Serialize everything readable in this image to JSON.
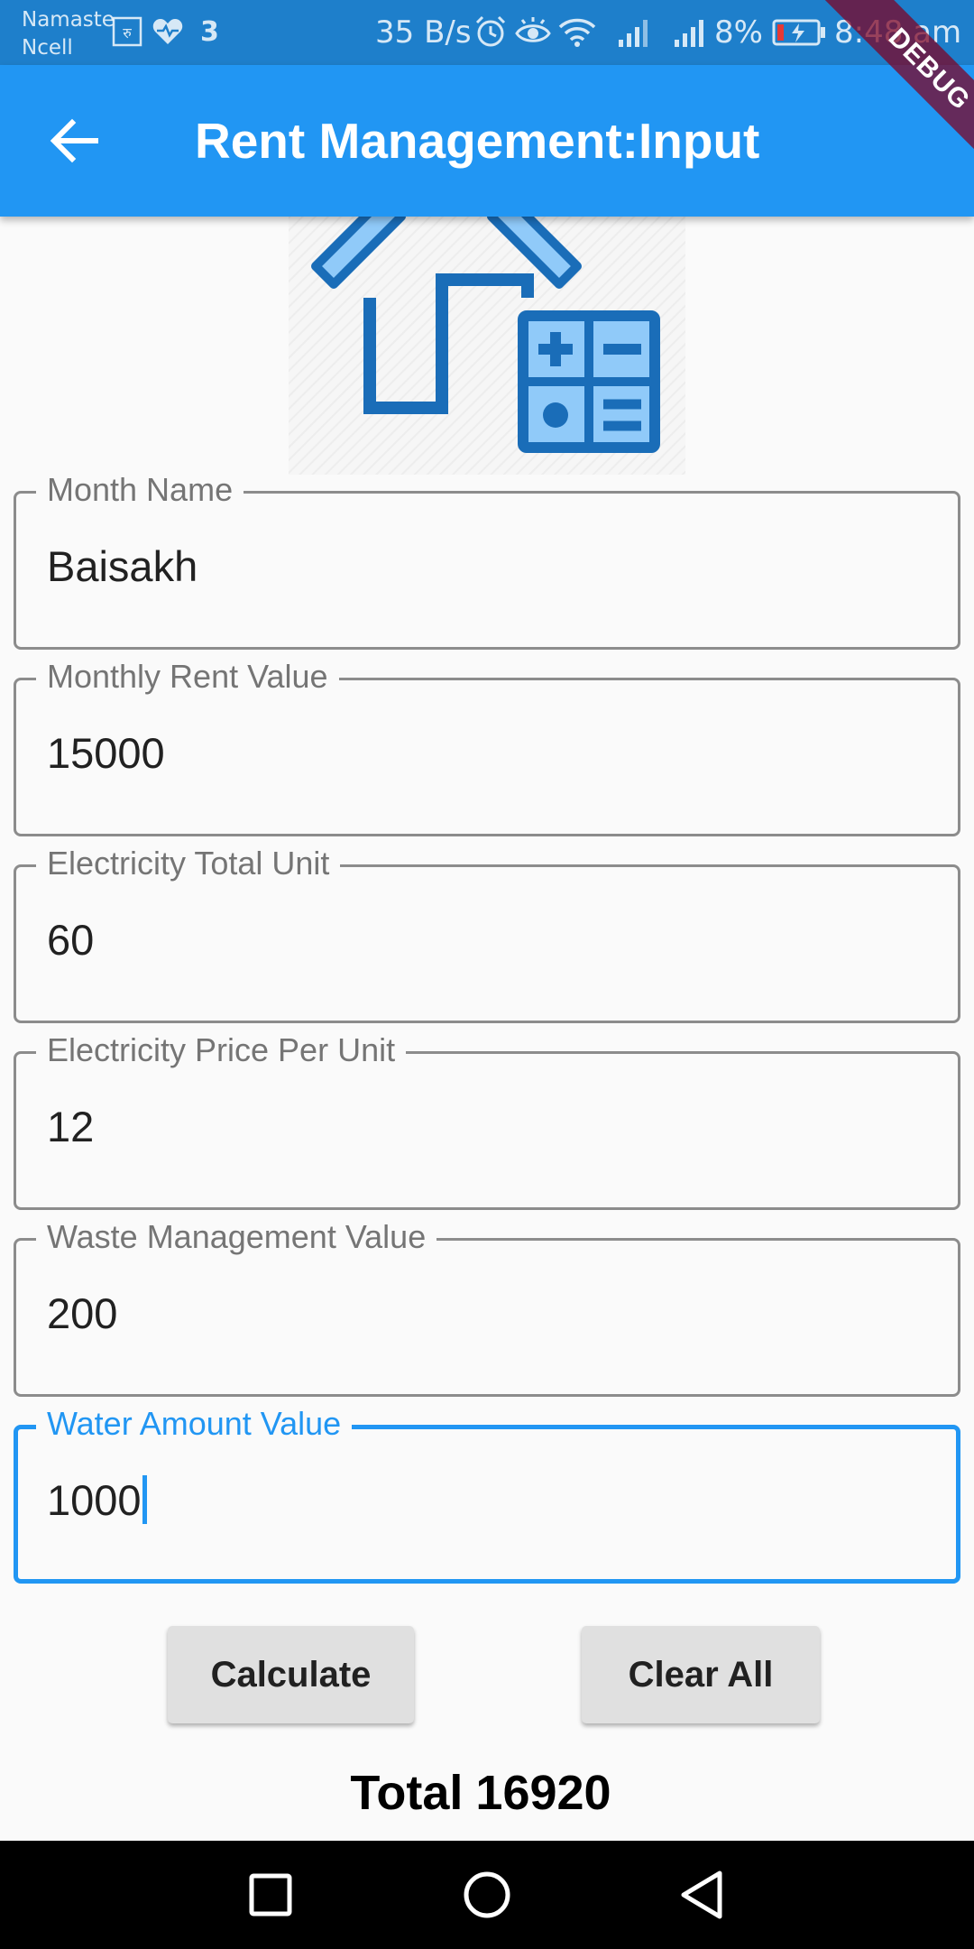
{
  "status_bar": {
    "carrier_line1": "Namaste",
    "carrier_line2": "Ncell",
    "notification_count": "3",
    "network_speed": "35 B/s",
    "battery_percent": "8%",
    "time": "8:48 am"
  },
  "app_bar": {
    "title": "Rent Management:Input",
    "back_icon": "arrow-back-icon"
  },
  "debug_banner": "DEBUG",
  "logo_icon": "house-calculator-icon",
  "fields": [
    {
      "label": "Month Name",
      "value": "Baisakh"
    },
    {
      "label": "Monthly Rent Value",
      "value": "15000"
    },
    {
      "label": "Electricity Total Unit",
      "value": "60"
    },
    {
      "label": "Electricity Price Per Unit",
      "value": "12"
    },
    {
      "label": "Waste Management Value",
      "value": "200"
    },
    {
      "label": "Water Amount Value",
      "value": "1000",
      "focused": true
    }
  ],
  "buttons": {
    "calculate": "Calculate",
    "clear_all": "Clear All"
  },
  "total": {
    "label": "Total",
    "value": "16920"
  },
  "colors": {
    "primary": "#2196F3",
    "status_bar": "#1E7FCB",
    "logo_blue": "#1A6DB8",
    "logo_light": "#90CAF9"
  },
  "nav_bar": {
    "icons": [
      "recent-apps-icon",
      "home-icon",
      "back-icon"
    ]
  }
}
